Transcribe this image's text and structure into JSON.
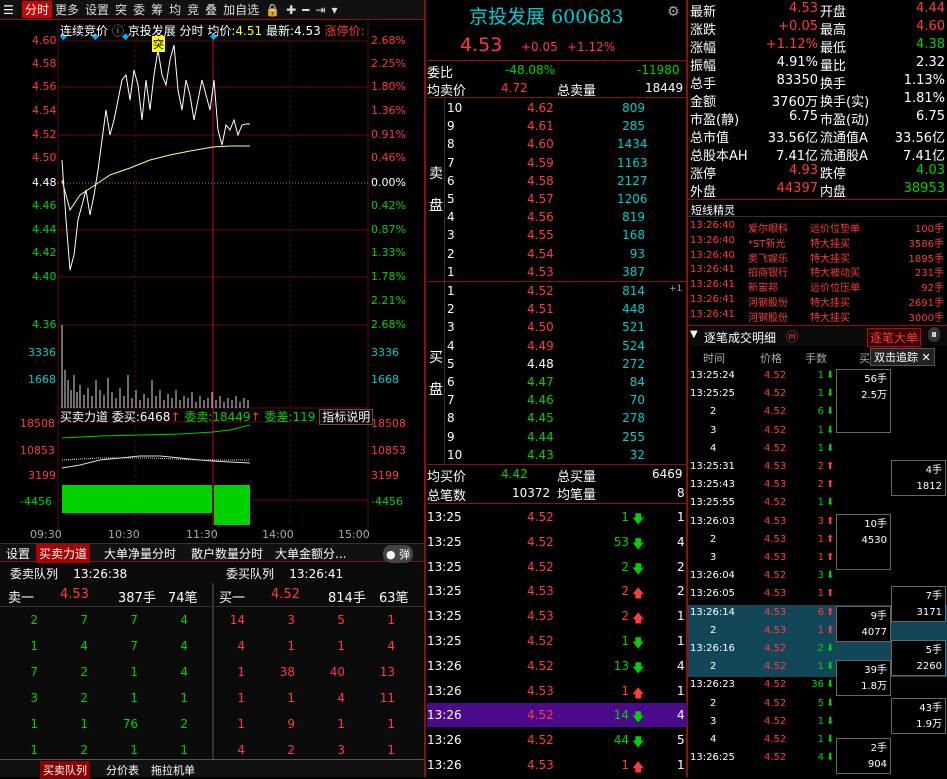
{
  "toolbar": {
    "items": [
      "分时",
      "更多",
      "设置",
      "突",
      "委",
      "筹",
      "均",
      "竞",
      "叠",
      "加自选"
    ],
    "icons": [
      "lock-icon",
      "plus-icon",
      "minus-icon",
      "step-right-icon",
      "dropdown-icon"
    ]
  },
  "chart": {
    "legend": {
      "auction": "连续竞价",
      "name": "京投发展",
      "mode": "分时",
      "avg_label": "均价:",
      "avg": "4.51",
      "last_label": "最新:",
      "last": "4.53",
      "limit_label": "涨停价:"
    },
    "price_axis": [
      {
        "v": "4.60",
        "p": "2.68%"
      },
      {
        "v": "4.58",
        "p": "2.25%"
      },
      {
        "v": "4.56",
        "p": "1.80%"
      },
      {
        "v": "4.54",
        "p": "1.36%"
      },
      {
        "v": "4.52",
        "p": "0.91%"
      },
      {
        "v": "4.50",
        "p": "0.46%"
      },
      {
        "v": "4.48",
        "p": "0.00%"
      },
      {
        "v": "4.46",
        "p": "0.42%"
      },
      {
        "v": "4.44",
        "p": "0.87%"
      },
      {
        "v": "4.42",
        "p": "1.33%"
      },
      {
        "v": "4.40",
        "p": "1.78%"
      },
      {
        "v": "4.38",
        "p": "2.21%"
      },
      {
        "v": "4.36",
        "p": "2.68%"
      }
    ],
    "vol_axis": [
      "3336",
      "1668"
    ],
    "flow_legend": {
      "t": "买卖力道",
      "b_label": "委买:",
      "b": "6468",
      "s_label": "委卖:",
      "s": "18449",
      "d_label": "委差:",
      "d": "119",
      "expl": "指标说明"
    },
    "flow_axis": [
      "18508",
      "10853",
      "3199",
      "-4456"
    ],
    "time_axis": [
      "09:30",
      "10:30",
      "11:30",
      "14:00",
      "15:00"
    ],
    "marker": "突"
  },
  "bottom_tabs": [
    "设置",
    "买卖力道",
    "大单净量分时",
    "散户数量分时",
    "大单金额分..."
  ],
  "bottom_toggle": "弹",
  "ask_queue": {
    "title": "委卖队列",
    "time": "13:26:38",
    "level": "卖一",
    "price": "4.53",
    "vol": "387手",
    "cnt": "74笔",
    "rows": [
      [
        "2",
        "7",
        "7",
        "4"
      ],
      [
        "1",
        "4",
        "7",
        "4"
      ],
      [
        "7",
        "2",
        "1",
        "4"
      ],
      [
        "3",
        "2",
        "1",
        "1"
      ],
      [
        "1",
        "1",
        "76",
        "2"
      ],
      [
        "1",
        "2",
        "1",
        "1"
      ]
    ]
  },
  "bid_queue": {
    "title": "委买队列",
    "time": "13:26:41",
    "level": "买一",
    "price": "4.52",
    "vol": "814手",
    "cnt": "63笔",
    "rows": [
      [
        "14",
        "3",
        "5",
        "1"
      ],
      [
        "4",
        "1",
        "1",
        "4"
      ],
      [
        "1",
        "38",
        "40",
        "13"
      ],
      [
        "1",
        "1",
        "4",
        "11"
      ],
      [
        "1",
        "9",
        "1",
        "1"
      ],
      [
        "4",
        "2",
        "3",
        "1"
      ]
    ]
  },
  "footer_tabs": [
    "买卖队列",
    "分价表",
    "拖拉机单"
  ],
  "stock": {
    "name": "京投发展",
    "code": "600683",
    "price": "4.53",
    "chg": "+0.05",
    "pct": "+1.12%"
  },
  "order_book": {
    "wb_label": "委比",
    "wb": "-48.08%",
    "wc": "-11980",
    "avg_sell_label": "均卖价",
    "avg_sell": "4.72",
    "tot_sell_label": "总卖量",
    "tot_sell": "18449",
    "sell_side": "卖盘",
    "buy_side": "买盘",
    "asks": [
      [
        "10",
        "4.62",
        "809"
      ],
      [
        "9",
        "4.61",
        "285"
      ],
      [
        "8",
        "4.60",
        "1434"
      ],
      [
        "7",
        "4.59",
        "1163"
      ],
      [
        "6",
        "4.58",
        "2127"
      ],
      [
        "5",
        "4.57",
        "1206"
      ],
      [
        "4",
        "4.56",
        "819"
      ],
      [
        "3",
        "4.55",
        "168"
      ],
      [
        "2",
        "4.54",
        "93"
      ],
      [
        "1",
        "4.53",
        "387"
      ]
    ],
    "bids": [
      [
        "1",
        "4.52",
        "814",
        "+1"
      ],
      [
        "2",
        "4.51",
        "448",
        ""
      ],
      [
        "3",
        "4.50",
        "521",
        ""
      ],
      [
        "4",
        "4.49",
        "524",
        ""
      ],
      [
        "5",
        "4.48",
        "272",
        ""
      ],
      [
        "6",
        "4.47",
        "84",
        ""
      ],
      [
        "7",
        "4.46",
        "70",
        ""
      ],
      [
        "8",
        "4.45",
        "278",
        ""
      ],
      [
        "9",
        "4.44",
        "255",
        ""
      ],
      [
        "10",
        "4.43",
        "32",
        ""
      ]
    ],
    "avg_buy_label": "均买价",
    "avg_buy": "4.42",
    "tot_buy_label": "总买量",
    "tot_buy": "6469",
    "tot_cnt_label": "总笔数",
    "tot_cnt": "10372",
    "avg_cnt_label": "均笔量",
    "avg_cnt": "8"
  },
  "ticks": [
    [
      "13:25",
      "4.52",
      "1",
      "down",
      "1"
    ],
    [
      "13:25",
      "4.52",
      "53",
      "down",
      "4"
    ],
    [
      "13:25",
      "4.52",
      "2",
      "down",
      "2"
    ],
    [
      "13:25",
      "4.53",
      "2",
      "up",
      "2"
    ],
    [
      "13:25",
      "4.53",
      "2",
      "up",
      "1"
    ],
    [
      "13:25",
      "4.52",
      "1",
      "down",
      "1"
    ],
    [
      "13:26",
      "4.52",
      "13",
      "down",
      "4"
    ],
    [
      "13:26",
      "4.53",
      "1",
      "up",
      "1"
    ],
    [
      "13:26",
      "4.52",
      "14",
      "down",
      "4"
    ],
    [
      "13:26",
      "4.52",
      "44",
      "down",
      "5"
    ],
    [
      "13:26",
      "4.53",
      "1",
      "up",
      "1"
    ]
  ],
  "stats": [
    [
      "最新",
      "4.53",
      "开盘",
      "4.44"
    ],
    [
      "涨跌",
      "+0.05",
      "最高",
      "4.60"
    ],
    [
      "涨幅",
      "+1.12%",
      "最低",
      "4.38"
    ],
    [
      "振幅",
      "4.91%",
      "量比",
      "2.32"
    ],
    [
      "总手",
      "83350",
      "换手",
      "1.13%"
    ],
    [
      "金额",
      "3760万",
      "换手(实)",
      "1.81%"
    ],
    [
      "市盈(静)",
      "6.75",
      "市盈(动)",
      "6.75"
    ],
    [
      "总市值",
      "33.56亿",
      "流通值A",
      "33.56亿"
    ],
    [
      "总股本AH",
      "7.41亿",
      "流通股A",
      "7.41亿"
    ],
    [
      "涨停",
      "4.93",
      "跌停",
      "4.03"
    ],
    [
      "外盘",
      "44397",
      "内盘",
      "38953"
    ]
  ],
  "sprites": {
    "title": "短线精灵",
    "items": [
      [
        "13:26:40",
        "爱尔眼科",
        "远价位垫单",
        "100手"
      ],
      [
        "13:26:40",
        "*ST新光",
        "特大挂买",
        "3586手"
      ],
      [
        "13:26:40",
        "奥飞娱乐",
        "特大挂买",
        "1895手"
      ],
      [
        "13:26:41",
        "招商银行",
        "特大被动买",
        "231手"
      ],
      [
        "13:26:41",
        "新宙邦",
        "远价位压单",
        "92手"
      ],
      [
        "13:26:41",
        "河钢股份",
        "特大挂买",
        "2691手"
      ],
      [
        "13:26:41",
        "河钢股份",
        "特大挂买",
        "3000手"
      ]
    ]
  },
  "detail": {
    "title": "逐笔成交明细",
    "big_btn": "逐笔大单",
    "trace_btn": "双击追踪",
    "cols": [
      "时间",
      "价格",
      "手数",
      "买"
    ],
    "rows": [
      [
        "13:25:24",
        "4.52",
        "1",
        "down"
      ],
      [
        "13:25:25",
        "4.52",
        "1",
        "down"
      ],
      [
        "2",
        "4.52",
        "6",
        "down"
      ],
      [
        "3",
        "4.52",
        "1",
        "down"
      ],
      [
        "4",
        "4.52",
        "1",
        "down"
      ],
      [
        "13:25:31",
        "4.53",
        "2",
        "up"
      ],
      [
        "13:25:43",
        "4.53",
        "2",
        "up"
      ],
      [
        "13:25:55",
        "4.52",
        "1",
        "down"
      ],
      [
        "13:26:03",
        "4.53",
        "3",
        "up"
      ],
      [
        "2",
        "4.53",
        "1",
        "up"
      ],
      [
        "3",
        "4.53",
        "1",
        "up"
      ],
      [
        "13:26:04",
        "4.52",
        "3",
        "down"
      ],
      [
        "13:26:05",
        "4.53",
        "1",
        "up"
      ],
      [
        "13:26:14",
        "4.53",
        "6",
        "up"
      ],
      [
        "2",
        "4.53",
        "1",
        "up"
      ],
      [
        "13:26:16",
        "4.52",
        "2",
        "down"
      ],
      [
        "2",
        "4.52",
        "1",
        "down"
      ],
      [
        "13:26:23",
        "4.52",
        "36",
        "down"
      ],
      [
        "2",
        "4.52",
        "5",
        "down"
      ],
      [
        "3",
        "4.52",
        "1",
        "down"
      ],
      [
        "4",
        "4.52",
        "1",
        "down"
      ],
      [
        "13:26:25",
        "4.52",
        "4",
        "down"
      ]
    ],
    "boxes": [
      [
        "56手",
        "2.5万"
      ],
      [
        "4手",
        "1812"
      ],
      [
        "10手",
        "4530"
      ],
      [
        "7手",
        "3171"
      ],
      [
        "9手",
        "4077"
      ],
      [
        "5手",
        "2260"
      ],
      [
        "39手",
        "1.8万"
      ],
      [
        "43手",
        "1.9万"
      ],
      [
        "2手",
        "904"
      ]
    ]
  }
}
